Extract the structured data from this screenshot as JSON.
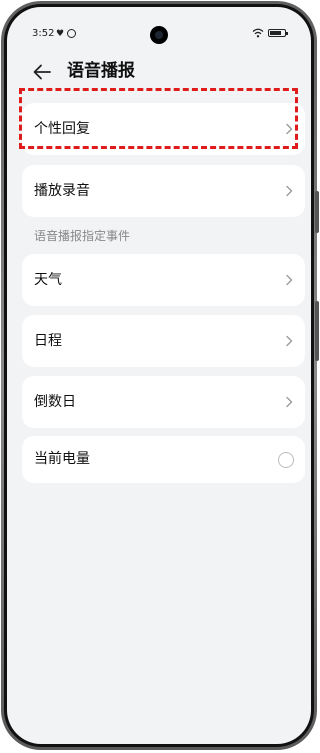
{
  "status_bar": {
    "time": "3:52"
  },
  "header": {
    "title": "语音播报"
  },
  "items": [
    {
      "label": "个性回复",
      "control": "chevron"
    },
    {
      "label": "播放录音",
      "control": "chevron"
    }
  ],
  "section": {
    "label": "语音播报指定事件"
  },
  "event_items": [
    {
      "label": "天气",
      "control": "chevron"
    },
    {
      "label": "日程",
      "control": "chevron"
    },
    {
      "label": "倒数日",
      "control": "chevron"
    },
    {
      "label": "当前电量",
      "control": "radio",
      "checked": false
    }
  ],
  "colors": {
    "background": "#f1f3f5",
    "card": "#ffffff",
    "highlight": "#e01b1b",
    "secondary_text": "#888888"
  },
  "icons": {
    "back": "arrow-left-icon",
    "chevron": "chevron-right-icon"
  }
}
